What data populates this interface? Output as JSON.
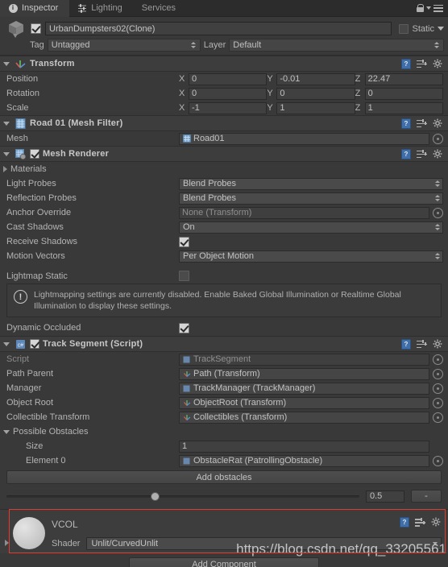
{
  "tabs": [
    {
      "label": "Inspector",
      "icon": "info-icon",
      "active": true
    },
    {
      "label": "Lighting",
      "icon": "lighting-icon",
      "active": false
    },
    {
      "label": "Services",
      "icon": "",
      "active": false
    }
  ],
  "tabbar": {
    "lock_icon": "lock-icon",
    "menu_icon": "hamburger-menu-icon"
  },
  "object_header": {
    "enabled": true,
    "name": "UrbanDumpsters02(Clone)",
    "static_label": "Static",
    "static_checked": false,
    "tag_label": "Tag",
    "tag_value": "Untagged",
    "layer_label": "Layer",
    "layer_value": "Default"
  },
  "components": [
    {
      "title": "Transform",
      "icon": "transform-axis-icon",
      "rows": [
        {
          "label": "Position",
          "x": "0",
          "y": "-0.01",
          "z": "22.47"
        },
        {
          "label": "Rotation",
          "x": "0",
          "y": "0",
          "z": "0"
        },
        {
          "label": "Scale",
          "x": "-1",
          "y": "1",
          "z": "1"
        }
      ],
      "axes": [
        "X",
        "Y",
        "Z"
      ]
    },
    {
      "title": "Road 01 (Mesh Filter)",
      "icon": "mesh-filter-icon",
      "mesh_label": "Mesh",
      "mesh_value": "Road01"
    },
    {
      "title": "Mesh Renderer",
      "icon": "mesh-renderer-icon",
      "enabled": true,
      "materials_label": "Materials",
      "props": [
        {
          "label": "Light Probes",
          "value": "Blend Probes",
          "type": "popup"
        },
        {
          "label": "Reflection Probes",
          "value": "Blend Probes",
          "type": "popup"
        },
        {
          "label": "Anchor Override",
          "value": "None (Transform)",
          "type": "object"
        },
        {
          "label": "Cast Shadows",
          "value": "On",
          "type": "popup"
        },
        {
          "label": "Receive Shadows",
          "value": "",
          "type": "toggle",
          "checked": true
        },
        {
          "label": "Motion Vectors",
          "value": "Per Object Motion",
          "type": "popup"
        },
        {
          "label": "Lightmap Static",
          "value": "",
          "type": "toggle",
          "checked": false
        }
      ],
      "helpbox": "Lightmapping settings are currently disabled. Enable Baked Global Illumination or Realtime Global Illumination to display these settings.",
      "dynamic_occluded_label": "Dynamic Occluded",
      "dynamic_occluded_checked": true
    },
    {
      "title": "Track Segment (Script)",
      "icon": "csharp-script-icon",
      "enabled": true,
      "props": [
        {
          "label": "Script",
          "value": "TrackSegment",
          "icon": "script-asset-icon",
          "dim": true
        },
        {
          "label": "Path Parent",
          "value": "Path (Transform)",
          "icon": "transform-axis-icon",
          "dim": false
        },
        {
          "label": "Manager",
          "value": "TrackManager (TrackManager)",
          "icon": "script-asset-icon",
          "dim": false
        },
        {
          "label": "Object Root",
          "value": "ObjectRoot (Transform)",
          "icon": "transform-axis-icon",
          "dim": false
        },
        {
          "label": "Collectible Transform",
          "value": "Collectibles (Transform)",
          "icon": "transform-axis-icon",
          "dim": false
        }
      ],
      "array": {
        "label": "Possible Obstacles",
        "size_label": "Size",
        "size_value": "1",
        "element_label": "Element 0",
        "element_value": "ObstacleRat (PatrollingObstacle)"
      },
      "add_obstacles_label": "Add obstacles",
      "slider": {
        "value": "0.5",
        "percent": 42
      },
      "minus_label": "-"
    }
  ],
  "material": {
    "name": "VCOL",
    "shader_label": "Shader",
    "shader_value": "Unlit/CurvedUnlit",
    "highlight_color": "#e23b2e"
  },
  "footer": {
    "add_component_label": "Add Component",
    "watermark": "https://blog.csdn.net/qq_33205561"
  }
}
